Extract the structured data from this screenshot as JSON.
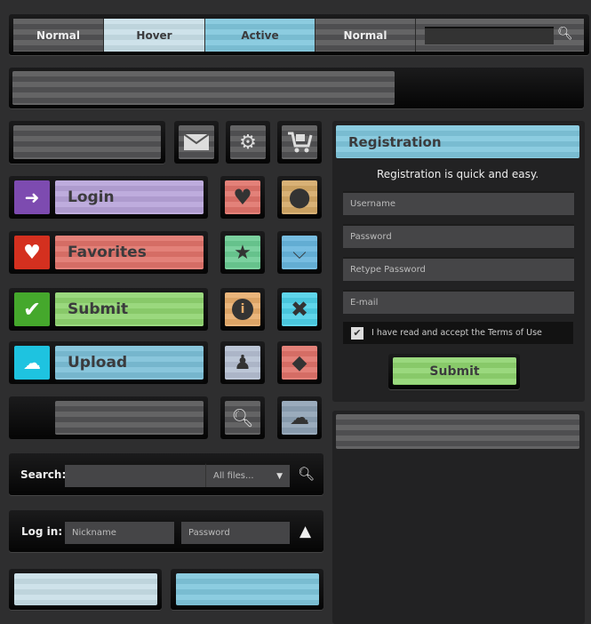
{
  "nav": {
    "tabs": [
      {
        "label": "Normal",
        "state": "normal"
      },
      {
        "label": "Hover",
        "state": "hover"
      },
      {
        "label": "Active",
        "state": "active"
      },
      {
        "label": "Normal",
        "state": "normal"
      }
    ],
    "search_icon": "search-icon"
  },
  "toolbar_icons": [
    "mail-icon",
    "gears-icon",
    "cart-icon"
  ],
  "buttons": [
    {
      "label": "Login",
      "icon": "login-icon",
      "icon_color": "#7d4bb0",
      "color": "#b7a3d9"
    },
    {
      "label": "Favorites",
      "icon": "heart-icon",
      "icon_color": "#d4301f",
      "color": "#e0736a"
    },
    {
      "label": "Submit",
      "icon": "check-icon",
      "icon_color": "#45a82c",
      "color": "#8fd46f"
    },
    {
      "label": "Upload",
      "icon": "cloud-upload-icon",
      "icon_color": "#1ec3e0",
      "color": "#7cc0d8"
    }
  ],
  "icon_grid": [
    [
      "heart-icon",
      "map-pin-icon"
    ],
    [
      "star-icon",
      "chevron-down-icon"
    ],
    [
      "info-icon",
      "close-icon"
    ],
    [
      "user-icon",
      "tag-icon"
    ],
    [
      "search-icon",
      "cloud-upload-icon"
    ]
  ],
  "registration": {
    "title": "Registration",
    "subtitle": "Registration is quick and easy.",
    "username": "Username",
    "password": "Password",
    "retype": "Retype Password",
    "email": "E-mail",
    "terms": "I have read and accept the Terms of Use",
    "terms_checked": true,
    "submit": "Submit"
  },
  "search": {
    "label": "Search:",
    "scope": "All files..."
  },
  "login": {
    "label": "Log in:",
    "nickname": "Nickname",
    "password": "Password"
  },
  "colors": {
    "accent_blue": "#7fc6dc",
    "hover": "#c8dfe8",
    "green": "#8fd46f"
  }
}
